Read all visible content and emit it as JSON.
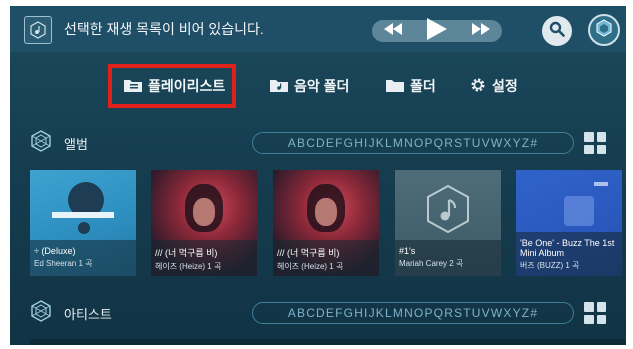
{
  "topbar": {
    "now_playing_text": "선택한 재생 목록이 비어 있습니다."
  },
  "tabs": [
    {
      "label": "플레이리스트",
      "icon": "playlist-folder-icon",
      "selected": true
    },
    {
      "label": "음악 폴더",
      "icon": "music-folder-icon",
      "selected": false
    },
    {
      "label": "폴더",
      "icon": "folder-icon",
      "selected": false
    },
    {
      "label": "설정",
      "icon": "gear-icon",
      "selected": false
    }
  ],
  "albums_section": {
    "title": "앨범",
    "alphabet": "ABCDEFGHIJKLMNOPQRSTUVWXYZ#"
  },
  "artists_section": {
    "title": "아티스트",
    "alphabet": "ABCDEFGHIJKLMNOPQRSTUVWXYZ#"
  },
  "albums": [
    {
      "name": "÷ (Deluxe)",
      "artist": "Ed Sheeran 1 곡"
    },
    {
      "name": "/// (너 먹구름 비)",
      "artist": "헤이즈 (Heize) 1 곡"
    },
    {
      "name": "/// (너 먹구름 비)",
      "artist": "헤이즈 (Heize) 1 곡"
    },
    {
      "name": "#1's",
      "artist": "Mariah Carey 2 곡"
    },
    {
      "name": "'Be One' - Buzz The 1st Mini Album",
      "artist": "버즈 (BUZZ) 1 곡"
    }
  ],
  "colors": {
    "accent_selected": "#e0201b",
    "background": "#163d50"
  }
}
